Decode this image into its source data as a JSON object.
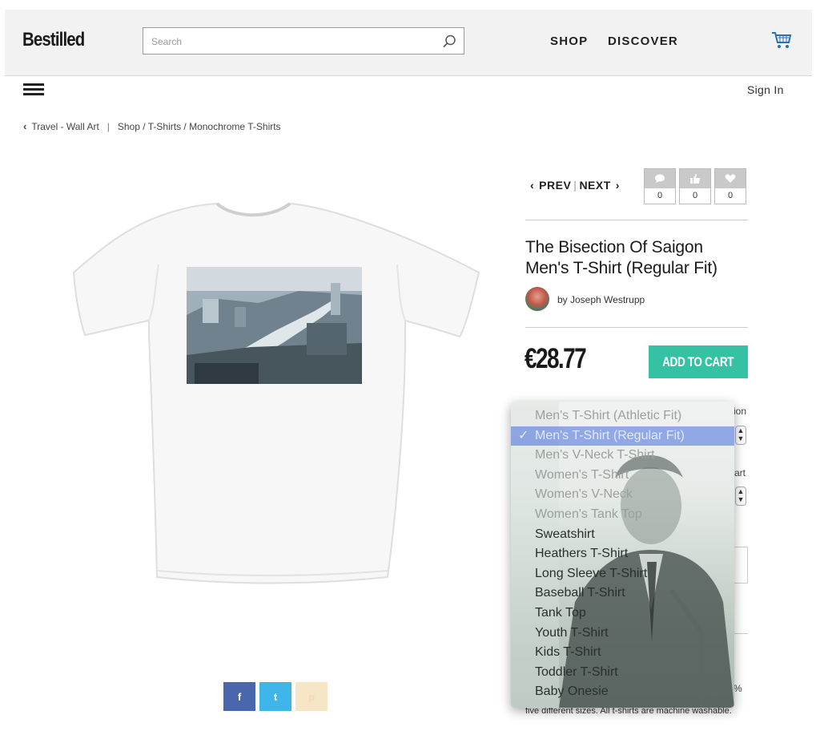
{
  "header": {
    "logo": "Bestilled",
    "search_placeholder": "Search",
    "nav": {
      "shop": "SHOP",
      "discover": "DISCOVER"
    }
  },
  "subheader": {
    "signin": "Sign In"
  },
  "breadcrumb": {
    "back_label": "Travel - Wall Art",
    "separator": "|",
    "path": "Shop / T-Shirts / Monochrome T-Shirts"
  },
  "product": {
    "prev_label": "PREV",
    "next_label": "NEXT",
    "pipe": "|",
    "stats": {
      "comments": "0",
      "likes": "0",
      "favorites": "0"
    },
    "title_line1": "The Bisection Of Saigon",
    "title_line2": "Men's T-Shirt (Regular Fit)",
    "byline": "by Joseph Westrupp",
    "price": "€28.77",
    "add_to_cart": "ADD TO CART",
    "description": "five different sizes.   All t-shirts are machine washable."
  },
  "hidden_fragments": {
    "frag1": "ion",
    "frag2": "art",
    "frag3": "%"
  },
  "dropdown": {
    "check": "✓",
    "selected_index": 1,
    "options": [
      "Men's T-Shirt (Athletic Fit)",
      "Men's T-Shirt (Regular Fit)",
      "Men's V-Neck T-Shirt",
      "Women's T-Shirt",
      "Women's V-Neck",
      "Women's Tank Top",
      "Sweatshirt",
      "Heathers T-Shirt",
      "Long Sleeve T-Shirt",
      "Baseball T-Shirt",
      "Tank Top",
      "Youth T-Shirt",
      "Kids T-Shirt",
      "Toddler T-Shirt",
      "Baby Onesie"
    ]
  },
  "share": {
    "facebook": "f",
    "twitter": "t",
    "pinterest": "p"
  },
  "colors": {
    "accent": "#35c2a4",
    "facebook": "#4a67ae",
    "twitter": "#3fb6e9",
    "pinterest": "#f6e6c6"
  }
}
